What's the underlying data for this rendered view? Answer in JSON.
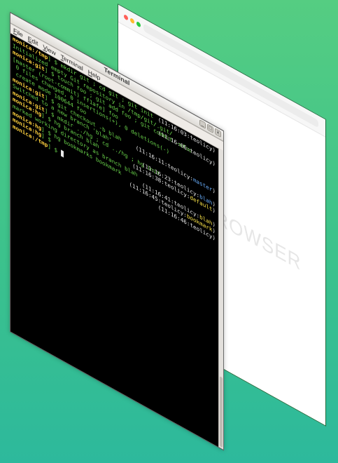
{
  "browser": {
    "watermark": "BROWSER",
    "dots": [
      "#ff5f57",
      "#febc2e",
      "#28c840"
    ]
  },
  "terminal": {
    "title": "Terminal",
    "menu": [
      "File",
      "Edit",
      "View",
      "Terminal",
      "Help"
    ],
    "window_buttons": [
      "_",
      "□",
      "x"
    ],
    "lines": [
      {
        "left": [
          {
            "t": "monica:",
            "c": "u"
          },
          {
            "t": "/tmp",
            "c": "u"
          },
          {
            "t": "] $ mkdir git ; cd git ; git init",
            "c": "b"
          }
        ],
        "right": "(11:16:03:teolicy)"
      },
      {
        "left": [
          {
            "t": "Initialized empty Git repository in /tmp/git/.git/",
            "c": "b"
          }
        ],
        "right": ""
      },
      {
        "left": [
          {
            "t": "monica:",
            "c": "u"
          },
          {
            "t": "git",
            "c": "u"
          },
          {
            "t": "] $ touch foo ; git add foo ; git commit -mfoo",
            "c": "b"
          }
        ],
        "right": "(11:16:06:teolicy)"
      },
      {
        "left": [
          {
            "t": "[master (root-commit) ff1afe] foo",
            "c": "b"
          }
        ],
        "right": ""
      },
      {
        "left": [
          {
            "t": " 0 files changed, 0 insertions(+), 0 deletions(-)",
            "c": "b"
          }
        ],
        "right": ""
      },
      {
        "left": [
          {
            "t": " create mode 100644 foo",
            "c": "b"
          }
        ],
        "right": ""
      },
      {
        "left": [
          {
            "t": "monica:",
            "c": "u"
          },
          {
            "t": "git",
            "c": "u"
          },
          {
            "t": "] $ git checkout -b blah",
            "c": "b"
          }
        ],
        "right": "(11:16:11:teolicy:master)"
      },
      {
        "left": [
          {
            "t": "Switched to a new branch 'blah'",
            "c": "b"
          }
        ],
        "right": ""
      },
      {
        "left": [
          {
            "t": "monica:",
            "c": "u"
          },
          {
            "t": "git",
            "c": "u"
          },
          {
            "t": "] $ mkdir ../hg ; cd ../hg ; hg init",
            "c": "b"
          }
        ],
        "right": "(11:16:23:teolicy:blah)"
      },
      {
        "left": [
          {
            "t": "monica:",
            "c": "u"
          },
          {
            "t": "hg",
            "c": "u"
          },
          {
            "t": "] $ hg branch blah",
            "c": "b"
          }
        ],
        "right": "(11:16:38:teolicy:default)"
      },
      {
        "left": [
          {
            "t": "marked working directory as branch blah",
            "c": "b"
          }
        ],
        "right": ""
      },
      {
        "left": [
          {
            "t": "monica:",
            "c": "u"
          },
          {
            "t": "hg",
            "c": "u"
          },
          {
            "t": "] $ hg bookmarks bookmark",
            "c": "b"
          }
        ],
        "right": "(11:16:41:teolicy:blah)"
      },
      {
        "left": [
          {
            "t": "monica:",
            "c": "u"
          },
          {
            "t": "hg",
            "c": "u"
          },
          {
            "t": "] $ ",
            "c": "b"
          }
        ],
        "right": "(11:16:45:teolicy:bookmark)"
      },
      {
        "left": [
          {
            "t": "monica:",
            "c": "u"
          },
          {
            "t": "/tmp",
            "c": "u"
          },
          {
            "t": "] $ ",
            "c": "b"
          }
        ],
        "right": "(11:16:46:teolicy)"
      }
    ]
  }
}
